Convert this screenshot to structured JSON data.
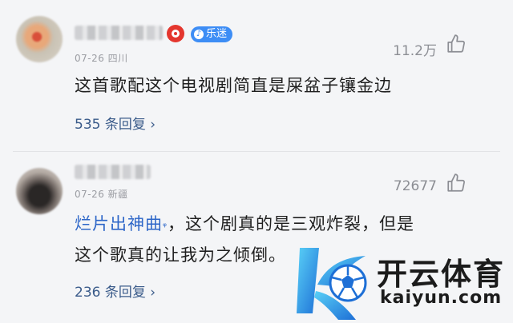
{
  "comments": [
    {
      "level_badge": "乐迷",
      "date_location": "07-26 四川",
      "likes": "11.2万",
      "text": "这首歌配这个电视剧简直是屎盆子镶金边",
      "replies": "535 条回复"
    },
    {
      "date_location": "07-26 新疆",
      "likes": "72677",
      "topic": "烂片出神曲",
      "text_line1": "，这个剧真的是三观炸裂，但是",
      "text_line2": "这个歌真的让我为之倾倒。",
      "replies": "236 条回复"
    }
  ],
  "watermark": {
    "cn": "开云体育",
    "en": "kaiyun.com"
  },
  "colors": {
    "link": "#3a5b8a",
    "topic": "#2d66c8",
    "badge": "#3d8df5",
    "music_badge": "#e4362e"
  }
}
